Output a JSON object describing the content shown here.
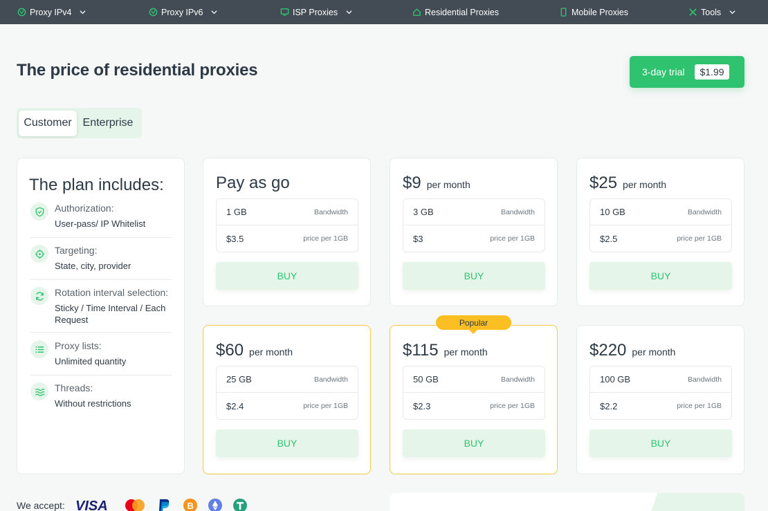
{
  "nav": {
    "items": [
      {
        "label": "Proxy IPv4",
        "icon": "globe-shield-icon",
        "dropdown": true
      },
      {
        "label": "Proxy IPv6",
        "icon": "globe-shield-icon",
        "dropdown": true
      },
      {
        "label": "ISP Proxies",
        "icon": "monitor-icon",
        "dropdown": true
      },
      {
        "label": "Residential Proxies",
        "icon": "home-icon",
        "dropdown": false
      },
      {
        "label": "Mobile Proxies",
        "icon": "smartphone-icon",
        "dropdown": false
      },
      {
        "label": "Tools",
        "icon": "tools-icon",
        "dropdown": true
      }
    ]
  },
  "page": {
    "title": "The price of residential proxies",
    "trial_label": "3-day trial",
    "trial_price": "$1.99"
  },
  "tabs": {
    "customer": "Customer",
    "enterprise": "Enterprise",
    "active": "Customer"
  },
  "features": {
    "title": "The plan includes:",
    "items": [
      {
        "label": "Authorization:",
        "value": "User-pass/ IP Whitelist",
        "icon": "shield-check-icon"
      },
      {
        "label": "Targeting:",
        "value": "State, city, provider",
        "icon": "target-icon"
      },
      {
        "label": "Rotation interval selection:",
        "value": "Sticky / Time Interval / Each Request",
        "icon": "refresh-icon"
      },
      {
        "label": "Proxy lists:",
        "value": "Unlimited quantity",
        "icon": "list-icon"
      },
      {
        "label": "Threads:",
        "value": "Without restrictions",
        "icon": "waves-icon"
      }
    ]
  },
  "plans": [
    {
      "price": "Pay as go",
      "per": "",
      "bandwidth": "1 GB",
      "bandwidth_label": "Bandwidth",
      "price_per_gb": "$3.5",
      "price_per_gb_label": "price per 1GB",
      "button": "BUY",
      "popular": false
    },
    {
      "price": "$9",
      "per": "per month",
      "bandwidth": "3 GB",
      "bandwidth_label": "Bandwidth",
      "price_per_gb": "$3",
      "price_per_gb_label": "price per 1GB",
      "button": "BUY",
      "popular": false
    },
    {
      "price": "$25",
      "per": "per month",
      "bandwidth": "10 GB",
      "bandwidth_label": "Bandwidth",
      "price_per_gb": "$2.5",
      "price_per_gb_label": "price per 1GB",
      "button": "BUY",
      "popular": false
    },
    {
      "price": "$60",
      "per": "per month",
      "bandwidth": "25 GB",
      "bandwidth_label": "Bandwidth",
      "price_per_gb": "$2.4",
      "price_per_gb_label": "price per 1GB",
      "button": "BUY",
      "popular": false
    },
    {
      "price": "$115",
      "per": "per month",
      "bandwidth": "50 GB",
      "bandwidth_label": "Bandwidth",
      "price_per_gb": "$2.3",
      "price_per_gb_label": "price per 1GB",
      "button": "BUY",
      "popular": true
    },
    {
      "price": "$220",
      "per": "per month",
      "bandwidth": "100 GB",
      "bandwidth_label": "Bandwidth",
      "price_per_gb": "$2.2",
      "price_per_gb_label": "price per 1GB",
      "button": "BUY",
      "popular": false
    }
  ],
  "popular_label": "Popular",
  "payments": {
    "label": "We accept:",
    "methods": [
      "visa-logo",
      "mastercard-logo",
      "paypal-logo",
      "bitcoin-icon",
      "ethereum-icon",
      "tether-icon"
    ]
  },
  "colors": {
    "nav_bg": "#434c54",
    "accent_green": "#2fc26f",
    "light_green": "#e5f5ea",
    "popular_yellow": "#fbbf24",
    "text_dark": "#2d3a45"
  }
}
